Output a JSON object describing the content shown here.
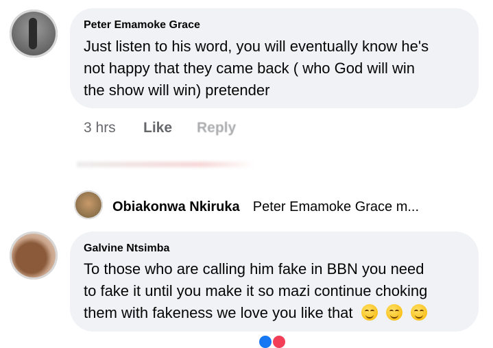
{
  "comments": [
    {
      "author": "Peter Emamoke Grace",
      "lines": [
        "Just listen to his word, you will eventually know he's",
        "not happy that they came back ( who God will win",
        "the show will win)  pretender"
      ],
      "time": "3 hrs",
      "like_label": "Like",
      "reply_label": "Reply"
    },
    {
      "author": "Galvine Ntsimba",
      "lines": [
        "To those who are calling him fake in BBN you need",
        "to fake it until you make it so mazi continue choking",
        "them with fakeness we love you like that"
      ],
      "emojis": [
        "smiling-face-emoji",
        "smiling-face-emoji",
        "smiling-face-emoji"
      ]
    }
  ],
  "reply_preview": {
    "author": "Obiakonwa Nkiruka",
    "snippet": "Peter Emamoke Grace m..."
  },
  "colors": {
    "bubble": "#f0f2f5",
    "meta": "#65676b",
    "text": "#050505"
  }
}
